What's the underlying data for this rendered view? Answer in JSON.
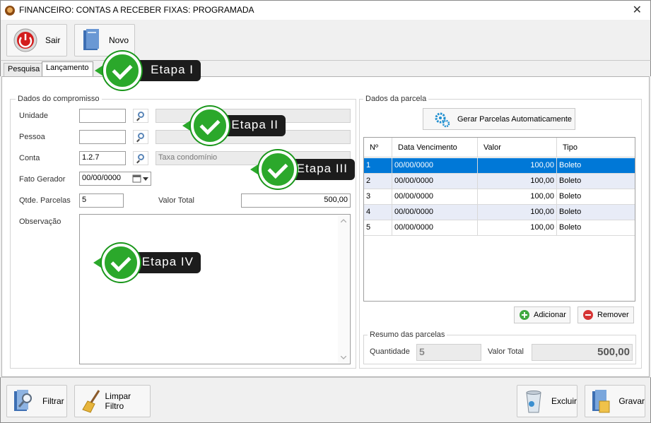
{
  "window": {
    "title": "FINANCEIRO: CONTAS A RECEBER FIXAS: PROGRAMADA",
    "close_glyph": "✕"
  },
  "toolbar": {
    "sair_label": "Sair",
    "novo_label": "Novo"
  },
  "tabs": [
    {
      "label": "Pesquisa"
    },
    {
      "label": "Lançamento"
    }
  ],
  "compromisso": {
    "title": "Dados do compromisso",
    "unidade_label": "Unidade",
    "unidade_value": "",
    "pessoa_label": "Pessoa",
    "pessoa_value": "",
    "conta_label": "Conta",
    "conta_value": "1.2.7",
    "conta_desc": "Taxa condomínio",
    "fato_label": "Fato Gerador",
    "fato_value": "00/00/0000",
    "qtde_label": "Qtde. Parcelas",
    "qtde_value": "5",
    "valor_total_label": "Valor Total",
    "valor_total_value": "500,00",
    "obs_label": "Observação"
  },
  "parcela": {
    "title": "Dados da parcela",
    "gerar_label": "Gerar Parcelas Automaticamente",
    "columns": [
      "Nº",
      "Data Vencimento",
      "Valor",
      "Tipo"
    ],
    "rows": [
      {
        "n": "1",
        "data": "00/00/0000",
        "valor": "100,00",
        "tipo": "Boleto"
      },
      {
        "n": "2",
        "data": "00/00/0000",
        "valor": "100,00",
        "tipo": "Boleto"
      },
      {
        "n": "3",
        "data": "00/00/0000",
        "valor": "100,00",
        "tipo": "Boleto"
      },
      {
        "n": "4",
        "data": "00/00/0000",
        "valor": "100,00",
        "tipo": "Boleto"
      },
      {
        "n": "5",
        "data": "00/00/0000",
        "valor": "100,00",
        "tipo": "Boleto"
      }
    ],
    "adicionar_label": "Adicionar",
    "remover_label": "Remover"
  },
  "resumo": {
    "title": "Resumo das parcelas",
    "quantidade_label": "Quantidade",
    "quantidade_value": "5",
    "valor_total_label": "Valor Total",
    "valor_total_value": "500,00"
  },
  "bottom": {
    "filtrar_label": "Filtrar",
    "limpar_label": "Limpar Filtro",
    "excluir_label": "Excluir",
    "gravar_label": "Gravar"
  },
  "callouts": {
    "etapa1": "Etapa I",
    "etapa2": "Etapa II",
    "etapa3": "Etapa III",
    "etapa4": "Etapa IV"
  },
  "colors": {
    "selection": "#0078d7",
    "check_green": "#2ba82b",
    "callout_bg": "#1c1c1c"
  }
}
